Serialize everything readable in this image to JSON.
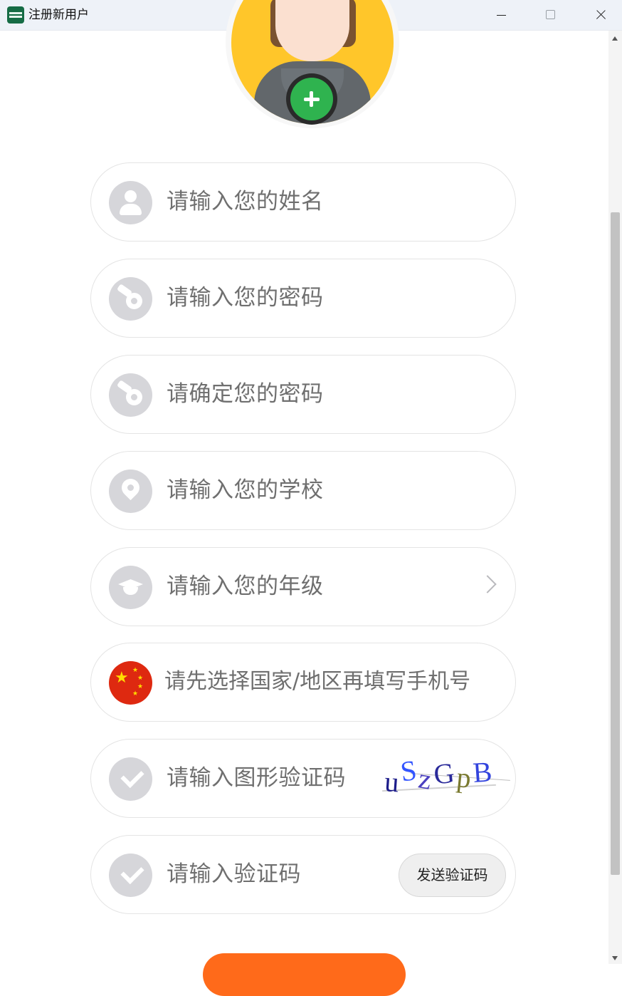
{
  "window": {
    "title": "注册新用户"
  },
  "form": {
    "fields": [
      {
        "placeholder": "请输入您的姓名",
        "icon": "user-icon"
      },
      {
        "placeholder": "请输入您的密码",
        "icon": "key-icon"
      },
      {
        "placeholder": "请确定您的密码",
        "icon": "key-icon"
      },
      {
        "placeholder": "请输入您的学校",
        "icon": "location-pin-icon"
      },
      {
        "placeholder": "请输入您的年级",
        "icon": "graduation-cap-icon"
      },
      {
        "placeholder": "请先选择国家/地区再填写手机号",
        "icon": "china-flag-icon"
      },
      {
        "placeholder": "请输入图形验证码",
        "icon": "check-icon"
      },
      {
        "placeholder": "请输入验证码",
        "icon": "check-icon"
      }
    ],
    "captcha_text": "uSzGpB",
    "send_code_label": "发送验证码"
  },
  "colors": {
    "icon_bg": "#d6d6da",
    "add_button": "#2fb34f",
    "avatar_bg": "#ffc62a",
    "submit_button": "#ff6a1a",
    "china_flag": "#de2910"
  }
}
